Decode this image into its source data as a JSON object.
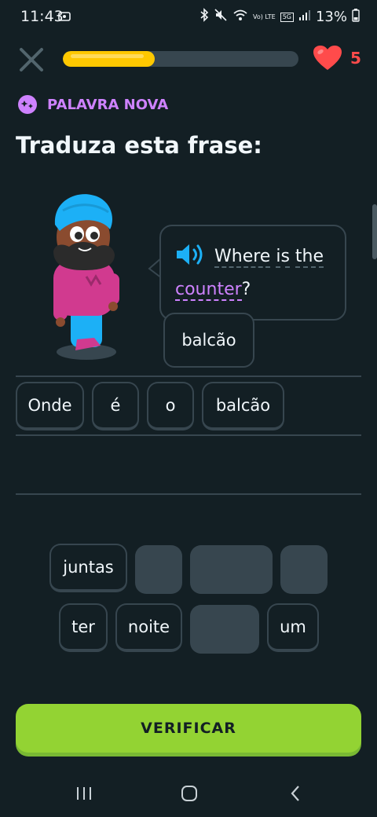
{
  "status_bar": {
    "time": "11:43",
    "lte_label": "Vo) LTE",
    "network_label": "5G",
    "battery": "13%"
  },
  "progress": {
    "fraction": 0.39,
    "fill_color": "#ffc800"
  },
  "hearts": {
    "count": "5",
    "color": "#ff4b4b"
  },
  "badge": {
    "label": "PALAVRA NOVA",
    "color": "#ce82ff"
  },
  "title": "Traduza esta frase:",
  "prompt": {
    "words": [
      "Where",
      "is",
      "the"
    ],
    "highlight_word": "counter",
    "end_punct": "?",
    "tooltip": "balcão"
  },
  "answer_chips": [
    "Onde",
    "é",
    "o",
    "balcão"
  ],
  "word_bank": {
    "row1": [
      "juntas"
    ],
    "row2": [
      "ter",
      "noite",
      "um"
    ]
  },
  "check_button": {
    "label": "VERIFICAR",
    "color": "#93d333"
  },
  "nav": {
    "recents": "recents-icon",
    "home": "home-icon",
    "back": "back-icon"
  }
}
